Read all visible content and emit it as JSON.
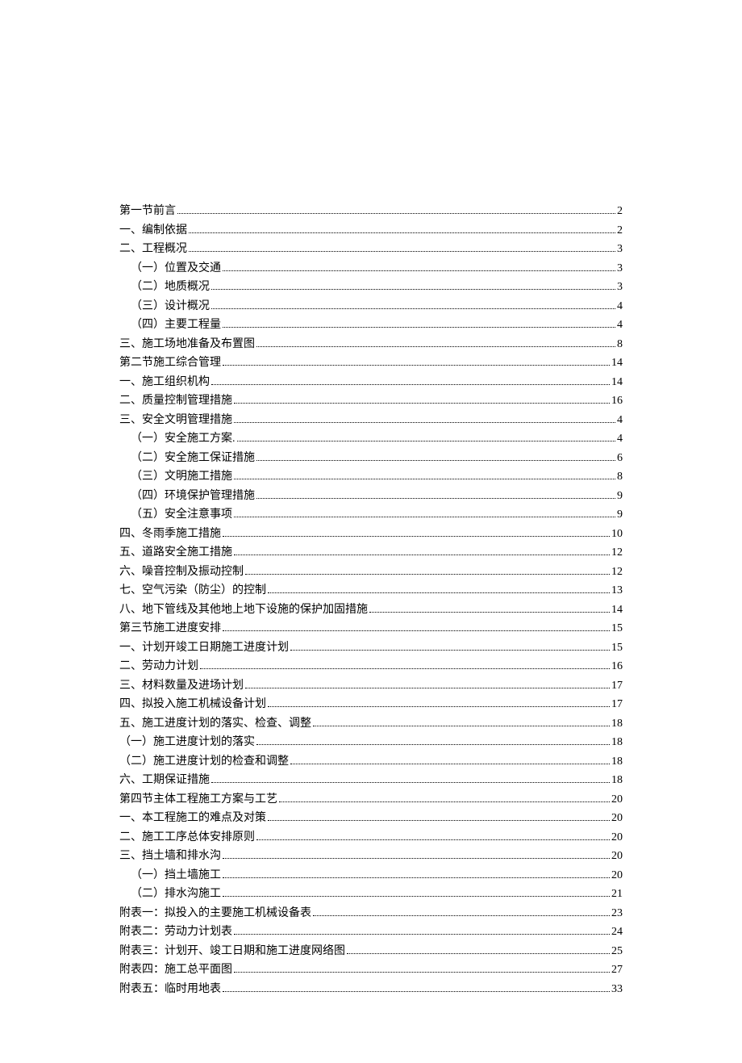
{
  "toc": [
    {
      "label": "第一节前言",
      "page": "2",
      "indent": 0
    },
    {
      "label": "一、编制依据",
      "page": "2",
      "indent": 0
    },
    {
      "label": "二、工程概况",
      "page": "3",
      "indent": 0
    },
    {
      "label": "（一）位置及交通",
      "page": "3",
      "indent": 1
    },
    {
      "label": "（二）地质概况",
      "page": "3",
      "indent": 1
    },
    {
      "label": "（三）设计概况",
      "page": "4",
      "indent": 1
    },
    {
      "label": "（四）主要工程量",
      "page": "4",
      "indent": 1
    },
    {
      "label": "三、施工场地准备及布置图",
      "page": "8",
      "indent": 0
    },
    {
      "label": "第二节施工综合管理",
      "page": "14",
      "indent": 0
    },
    {
      "label": "一、施工组织机构",
      "page": "14",
      "indent": 0
    },
    {
      "label": "二、质量控制管理措施",
      "page": "16",
      "indent": 0
    },
    {
      "label": "三、安全文明管理措施",
      "page": "4",
      "indent": 0
    },
    {
      "label": "（一）安全施工方案.",
      "page": "4",
      "indent": 1
    },
    {
      "label": "（二）安全施工保证措施",
      "page": "6",
      "indent": 1
    },
    {
      "label": "（三）文明施工措施",
      "page": "8",
      "indent": 1
    },
    {
      "label": "（四）环境保护管理措施",
      "page": "9",
      "indent": 1
    },
    {
      "label": "（五）安全注意事项",
      "page": "9",
      "indent": 1
    },
    {
      "label": "四、冬雨季施工措施",
      "page": "10",
      "indent": 0
    },
    {
      "label": "五、道路安全施工措施",
      "page": "12",
      "indent": 0
    },
    {
      "label": "六、噪音控制及振动控制",
      "page": "12",
      "indent": 0
    },
    {
      "label": "七、空气污染（防尘）的控制",
      "page": "13",
      "indent": 0
    },
    {
      "label": "八、地下管线及其他地上地下设施的保护加固措施",
      "page": "14",
      "indent": 0
    },
    {
      "label": "第三节施工进度安排",
      "page": "15",
      "indent": 0
    },
    {
      "label": "一、计划开竣工日期施工进度计划",
      "page": "15",
      "indent": 0
    },
    {
      "label": "二、劳动力计划",
      "page": "16",
      "indent": 0
    },
    {
      "label": "三、材料数量及进场计划",
      "page": "17",
      "indent": 0
    },
    {
      "label": "四、拟投入施工机械设备计划",
      "page": "17",
      "indent": 0
    },
    {
      "label": "五、施工进度计划的落实、检查、调整",
      "page": "18",
      "indent": 0
    },
    {
      "label": "（一）施工进度计划的落实",
      "page": "18",
      "indent": 0
    },
    {
      "label": "（二）施工进度计划的检查和调整",
      "page": "18",
      "indent": 0
    },
    {
      "label": "六、工期保证措施",
      "page": "18",
      "indent": 0
    },
    {
      "label": "第四节主体工程施工方案与工艺",
      "page": "20",
      "indent": 0
    },
    {
      "label": "一、本工程施工的难点及对策",
      "page": "20",
      "indent": 0
    },
    {
      "label": "二、施工工序总体安排原则",
      "page": "20",
      "indent": 0
    },
    {
      "label": "三、挡土墙和排水沟",
      "page": "20",
      "indent": 0
    },
    {
      "label": "（一）挡土墙施工",
      "page": "20",
      "indent": 1
    },
    {
      "label": "（二）排水沟施工",
      "page": "21",
      "indent": 1
    },
    {
      "label": "附表一：拟投入的主要施工机械设备表",
      "page": "23",
      "indent": 0
    },
    {
      "label": "附表二：劳动力计划表",
      "page": "24",
      "indent": 0
    },
    {
      "label": "附表三：计划开、竣工日期和施工进度网络图",
      "page": "25",
      "indent": 0
    },
    {
      "label": "附表四：施工总平面图",
      "page": "27",
      "indent": 0
    },
    {
      "label": "附表五：临时用地表",
      "page": "33",
      "indent": 0
    }
  ]
}
